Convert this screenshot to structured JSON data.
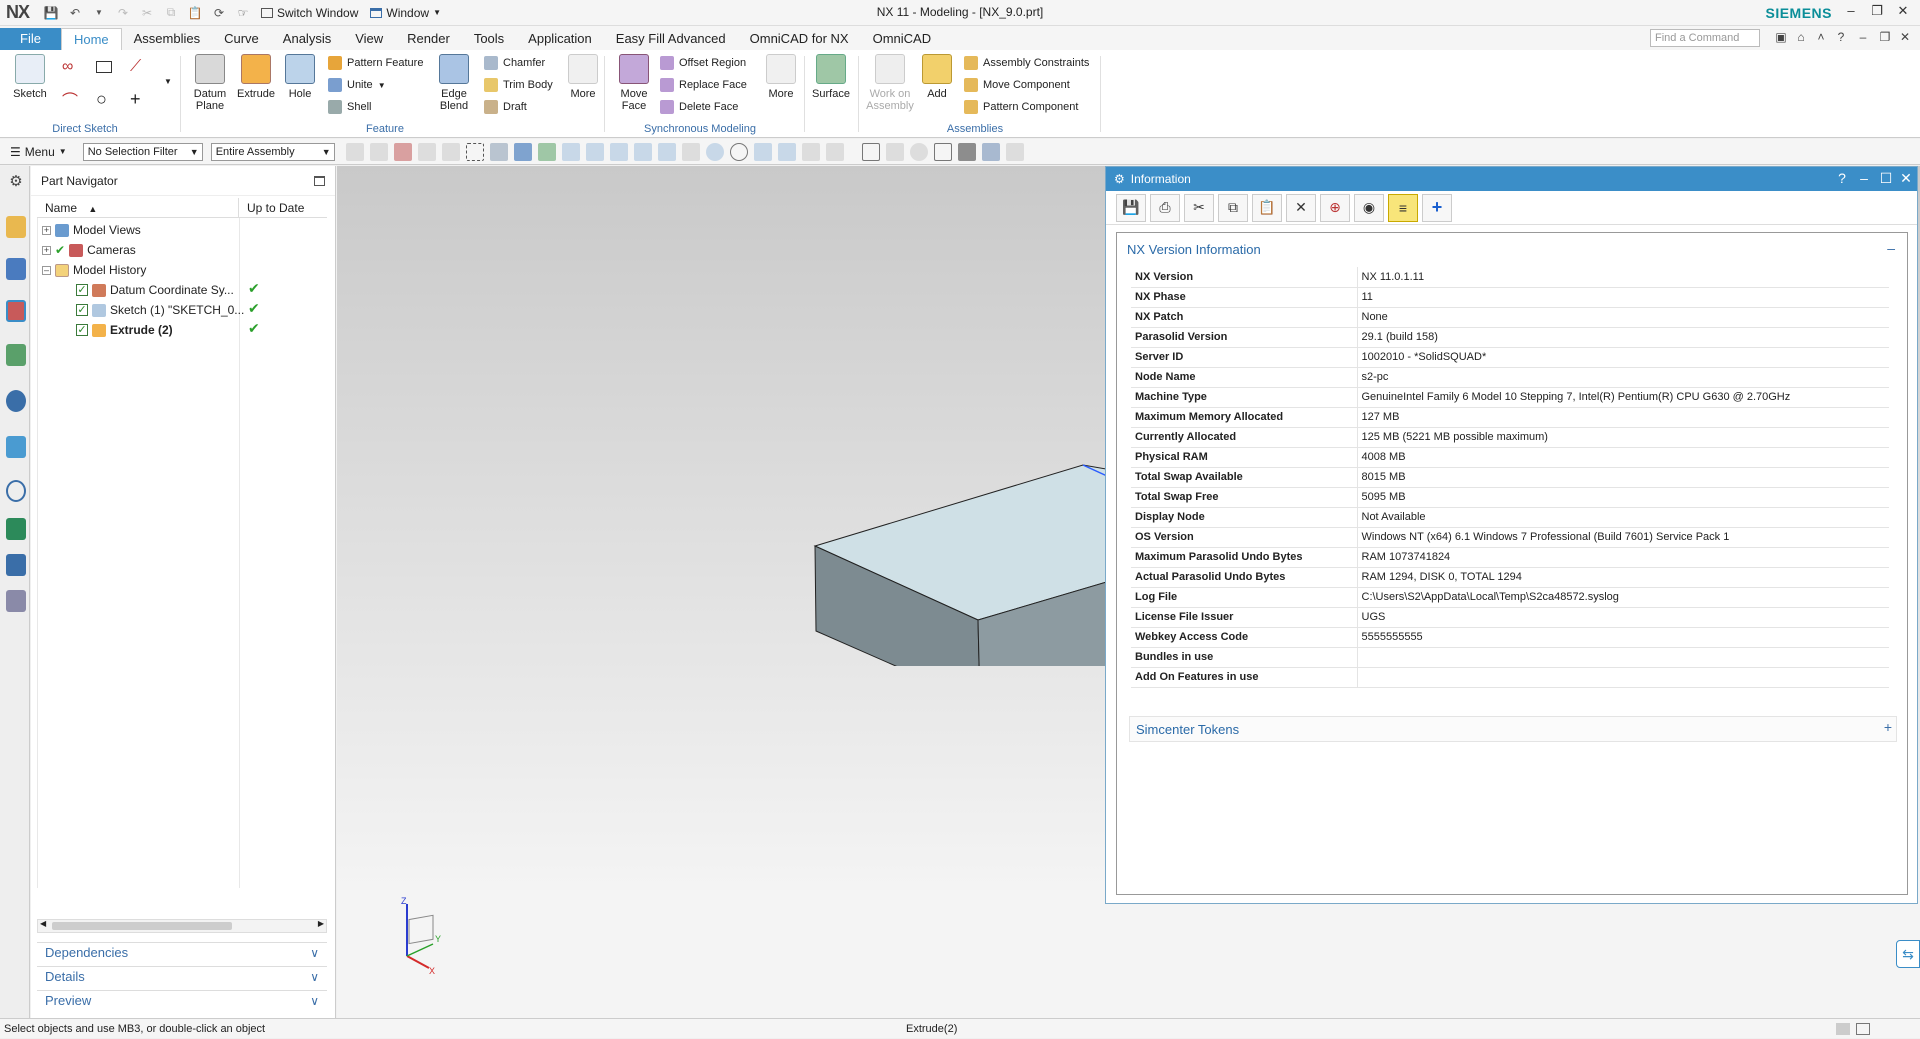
{
  "app": {
    "logo": "NX",
    "title": "NX 11 - Modeling - [NX_9.0.prt]",
    "brand": "SIEMENS",
    "switch_window": "Switch Window",
    "window_menu": "Window",
    "command_placeholder": "Find a Command"
  },
  "tabs": [
    "File",
    "Home",
    "Assemblies",
    "Curve",
    "Analysis",
    "View",
    "Render",
    "Tools",
    "Application",
    "Easy Fill Advanced",
    "OmniCAD for NX",
    "OmniCAD"
  ],
  "ribbon": {
    "sketch": "Sketch",
    "direct_sketch": "Direct Sketch",
    "datum_plane": "Datum Plane",
    "extrude": "Extrude",
    "hole": "Hole",
    "pattern_feature": "Pattern Feature",
    "unite": "Unite",
    "shell": "Shell",
    "feature": "Feature",
    "edge_blend": "Edge Blend",
    "chamfer": "Chamfer",
    "trim_body": "Trim Body",
    "draft": "Draft",
    "more1": "More",
    "move_face": "Move Face",
    "offset_region": "Offset Region",
    "replace_face": "Replace Face",
    "delete_face": "Delete Face",
    "more2": "More",
    "sync_modeling": "Synchronous Modeling",
    "surface": "Surface",
    "work_on_assembly": "Work on Assembly",
    "add": "Add",
    "assembly_constraints": "Assembly Constraints",
    "move_component": "Move Component",
    "pattern_component": "Pattern Component",
    "assemblies": "Assemblies"
  },
  "selbar": {
    "menu": "Menu",
    "filter": "No Selection Filter",
    "scope": "Entire Assembly"
  },
  "partnav": {
    "title": "Part Navigator",
    "col_name": "Name",
    "col_uptodate": "Up to Date",
    "rows": [
      {
        "label": "Model Views"
      },
      {
        "label": "Cameras"
      },
      {
        "label": "Model History"
      },
      {
        "label": "Datum Coordinate Sy..."
      },
      {
        "label": "Sketch (1) \"SKETCH_0..."
      },
      {
        "label": "Extrude (2)"
      }
    ],
    "panels": [
      "Dependencies",
      "Details",
      "Preview"
    ]
  },
  "triad": {
    "z": "Z",
    "y": "Y",
    "x": "X"
  },
  "info": {
    "title": "Information",
    "section1": "NX Version Information",
    "section2": "Simcenter Tokens",
    "rows": [
      {
        "k": "NX Version",
        "v": "NX 11.0.1.11"
      },
      {
        "k": "NX Phase",
        "v": "11"
      },
      {
        "k": "NX Patch",
        "v": "None"
      },
      {
        "k": "Parasolid Version",
        "v": "29.1 (build 158)"
      },
      {
        "k": "Server ID",
        "v": "1002010 - *SolidSQUAD*"
      },
      {
        "k": "Node Name",
        "v": "s2-pc"
      },
      {
        "k": "Machine Type",
        "v": "GenuineIntel Family 6 Model 10 Stepping 7, Intel(R) Pentium(R) CPU G630 @ 2.70GHz"
      },
      {
        "k": "Maximum Memory Allocated",
        "v": "127 MB"
      },
      {
        "k": "Currently Allocated",
        "v": "125 MB (5221 MB possible maximum)"
      },
      {
        "k": "Physical RAM",
        "v": "4008 MB"
      },
      {
        "k": "Total Swap Available",
        "v": "8015 MB"
      },
      {
        "k": "Total Swap Free",
        "v": "5095 MB"
      },
      {
        "k": "Display Node",
        "v": "Not Available"
      },
      {
        "k": "OS Version",
        "v": "Windows NT (x64) 6.1 Windows 7 Professional (Build 7601) Service Pack 1"
      },
      {
        "k": "Maximum Parasolid Undo Bytes",
        "v": "RAM 1073741824"
      },
      {
        "k": "Actual Parasolid Undo Bytes",
        "v": "RAM 1294, DISK 0, TOTAL 1294"
      },
      {
        "k": "Log File",
        "v": "C:\\Users\\S2\\AppData\\Local\\Temp\\S2ca48572.syslog"
      },
      {
        "k": "License File Issuer",
        "v": "UGS"
      },
      {
        "k": "Webkey Access Code",
        "v": "5555555555"
      },
      {
        "k": "Bundles in use",
        "v": ""
      },
      {
        "k": "Add On Features in use",
        "v": ""
      }
    ]
  },
  "status": {
    "prompt": "Select objects and use MB3, or double-click an object",
    "selection": "Extrude(2)"
  }
}
